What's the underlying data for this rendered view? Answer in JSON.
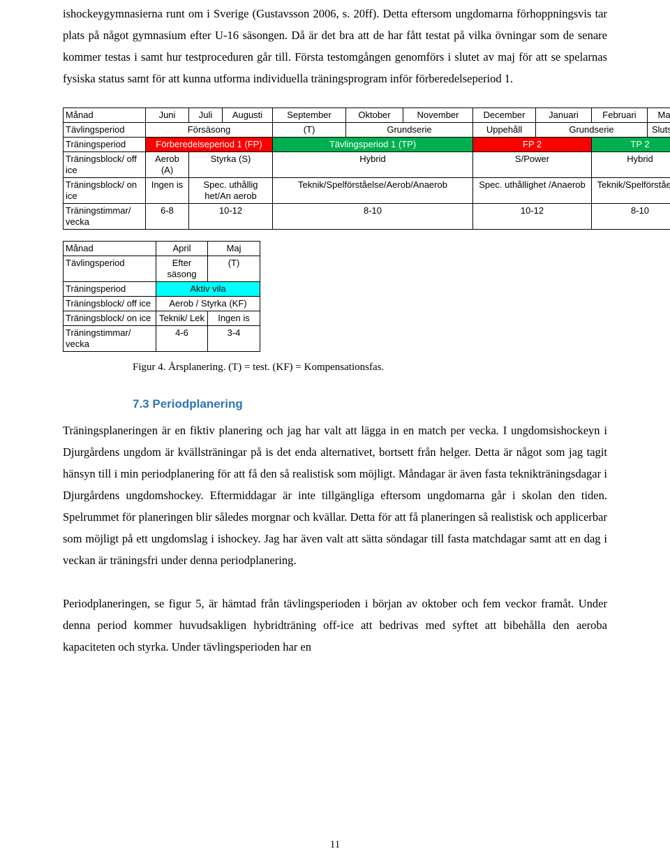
{
  "document": {
    "page_number": "11",
    "intro_paragraph": "ishockeygymnasierna runt om i Sverige (Gustavsson 2006, s. 20ff). Detta eftersom ungdomarna förhoppningsvis tar plats på något gymnasium efter U-16 säsongen. Då är det bra att de har fått testat på vilka övningar som de senare kommer testas i samt hur testproceduren går till. Första testomgången genomförs i slutet av maj för att se spelarnas fysiska status samt för att kunna utforma individuella träningsprogram inför förberedelseperiod 1.",
    "figure_caption": "Figur 4. Årsplanering. (T) = test. (KF) = Kompensationsfas.",
    "section_heading": "7.3 Periodplanering",
    "paragraph_1": "Träningsplaneringen är en fiktiv planering och jag har valt att lägga in en match per vecka. I ungdomsishockeyn i Djurgårdens ungdom är kvällsträningar på is det enda alternativet, bortsett från helger. Detta är något som jag tagit hänsyn till i min periodplanering för att få den så realistisk som möjligt. Måndagar är även fasta teknikträningsdagar i Djurgårdens ungdomshockey. Eftermiddagar är inte tillgängliga eftersom ungdomarna går i skolan den tiden. Spelrummet för planeringen blir således morgnar och kvällar. Detta för att få planeringen så realistisk och applicerbar som möjligt på ett ungdomslag i ishockey. Jag har även valt att sätta söndagar till fasta matchdagar samt att en dag i veckan är träningsfri under denna periodplanering.",
    "paragraph_2": "Periodplaneringen, se figur 5, är hämtad från tävlingsperioden i början av oktober och fem veckor framåt. Under denna period kommer huvudsakligen hybridträning off-ice att bedrivas med syftet att bibehålla den aeroba kapaciteten och styrka. Under tävlingsperioden har en"
  },
  "colors": {
    "red": "#ff0000",
    "green": "#00b050",
    "cyan": "#00ffff",
    "heading_blue": "#2e74b5"
  },
  "main_table": {
    "rows": [
      {
        "label": "Månad",
        "cells": [
          "Juni",
          "Juli",
          "Augusti",
          "September",
          "Oktober",
          "November",
          "December",
          "Januari",
          "Februari",
          "Mars"
        ]
      },
      {
        "label": "Tävlingsperiod",
        "cells": [
          "Försäsong",
          "(T)",
          "Grundserie",
          "Uppehåll",
          "Grundserie",
          "Slutspel"
        ]
      },
      {
        "label": "Träningsperiod",
        "cells": [
          "Förberedelseperiod 1 (FP)",
          "Tävlingsperiod 1 (TP)",
          "FP 2",
          "TP 2"
        ]
      },
      {
        "label": "Träningsblock/ off ice",
        "cells": [
          "Aerob (A)",
          "Styrka (S)",
          "Hybrid",
          "S/Power",
          "Hybrid"
        ]
      },
      {
        "label": "Träningsblock/ on ice",
        "cells": [
          "Ingen is",
          "Spec. uthållig het/An aerob",
          "Teknik/Spelförståelse/Aerob/Anaerob",
          "Spec. uthållighet /Anaerob",
          "Teknik/Spelförståelse"
        ]
      },
      {
        "label": "Träningstimmar/ vecka",
        "cells": [
          "6-8",
          "10-12",
          "8-10",
          "10-12",
          "8-10"
        ]
      }
    ]
  },
  "small_table": {
    "rows": [
      {
        "label": "Månad",
        "cells": [
          "April",
          "Maj"
        ]
      },
      {
        "label": "Tävlingsperiod",
        "cells": [
          "Efter säsong",
          "(T)"
        ]
      },
      {
        "label": "Träningsperiod",
        "cells": [
          "Aktiv vila"
        ]
      },
      {
        "label": "Träningsblock/ off ice",
        "cells": [
          "Aerob / Styrka (KF)"
        ]
      },
      {
        "label": "Träningsblock/ on ice",
        "cells": [
          "Teknik/ Lek",
          "Ingen is"
        ]
      },
      {
        "label": "Träningstimmar/ vecka",
        "cells": [
          "4-6",
          "3-4"
        ]
      }
    ]
  }
}
